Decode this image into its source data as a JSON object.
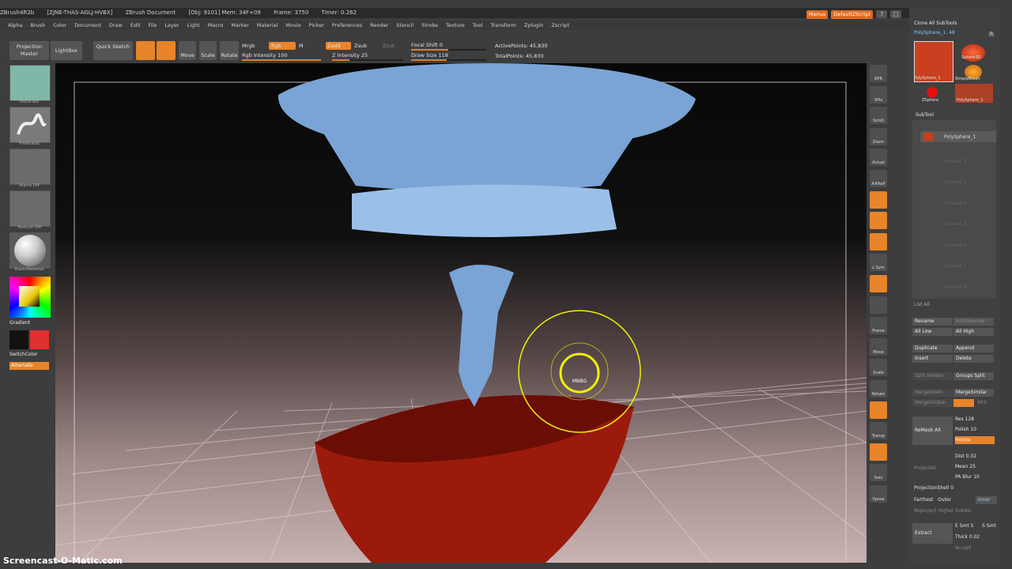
{
  "title_bar": {
    "app": "ZBrush4R2b",
    "session": "[ZJNE-THAS-AGLJ-HVBX]",
    "document": "ZBrush Document",
    "obj": "[Obj: 9101] Mem: 34F+09",
    "frame": "Frame: 3750",
    "timer": "Timer: 0.262"
  },
  "top_right": {
    "menus_chip": "Menus",
    "script_chip": "DefaultZScript",
    "win_btns": [
      "?",
      "□",
      "⊡",
      "–",
      "□",
      "✕"
    ]
  },
  "menu": [
    "Alpha",
    "Brush",
    "Color",
    "Document",
    "Draw",
    "Edit",
    "File",
    "Layer",
    "Light",
    "Macro",
    "Marker",
    "Material",
    "Movie",
    "Picker",
    "Preferences",
    "Render",
    "Stencil",
    "Stroke",
    "Texture",
    "Tool",
    "Transform",
    "Zplugin",
    "Zscript"
  ],
  "toolbar": {
    "projection_master": "Projection Master",
    "lightbox": "LightBox",
    "quick_sketch": "Quick Sketch",
    "move": "Move",
    "scale": "Scale",
    "rotate": "Rotate",
    "mrgb": "Mrgb",
    "rgb": "Rgb",
    "m": "M",
    "zadd": "Zadd",
    "zsub": "Zsub",
    "zcut": "Zcut",
    "rgb_intensity": "Rgb Intensity 100",
    "z_intensity": "Z Intensity 25",
    "focal_shift": "Focal Shift 0",
    "draw_size": "Draw Size 118",
    "active_points": "ActivePoints: 45,830",
    "total_points": "TotalPoints: 45,830"
  },
  "left_shelf": [
    "MoveTab",
    "Freehand",
    "Alpha Off",
    "Texture Off",
    "BasicMaterial"
  ],
  "colors": {
    "gradient": "Gradient",
    "switch_color": "SwitchColor",
    "alternate": "Alternate",
    "main_color": "#111111",
    "secondary_color": "#e03030",
    "accent": "#e8842a"
  },
  "viewport": {
    "brush_tag": "MNBG"
  },
  "right_icons": [
    "BPR",
    "SPix",
    "Scroll",
    "Zoom",
    "Actual",
    "AAHalf",
    "",
    "",
    "",
    "L.Sym",
    "",
    "",
    "Frame",
    "Move",
    "Scale",
    "Rotate",
    "",
    "Transp",
    "",
    "Solo",
    "Xpose"
  ],
  "right_panel": {
    "clone": "Clone All SubTools",
    "tool_name": "PolySphere_1. 48",
    "r_btn": "R",
    "tool_thumbs": [
      "PolySphere_1",
      "Sphere3D",
      "SimpleBrush",
      "ZSphere",
      "PolySphere_1"
    ],
    "subtool_header": "SubTool",
    "subtool_items": [
      "PolySphere_1",
      "Unused 2",
      "Unused 3",
      "Unused 4",
      "Unused 5",
      "Unused 6",
      "Unused 7",
      "Unused 8"
    ],
    "list_all": "List All",
    "rename": "Rename",
    "autoreorder": "AutoReorder",
    "all_low": "All Low",
    "all_high": "All High",
    "duplicate": "Duplicate",
    "append": "Append",
    "insert": "Insert",
    "delete": "Delete",
    "split_hidden": "Split Hidden",
    "groups_split": "Groups Split",
    "merge_down": "MergeDown",
    "merge_similar": "MergeSimilar",
    "merge_visible": "MergeVisible",
    "weld": "Wld",
    "remesh_all": "ReMesh All",
    "res": "Res 128",
    "polish": "Polish 10",
    "polygroups": "PolyGrp",
    "project_all": "ProjectAll",
    "dist": "Dist 0.02",
    "mean": "Mean 25",
    "pa_blur": "PA Blur 10",
    "projection_shell": "ProjectionShell 0",
    "farthest": "Farthest",
    "outer": "Outer",
    "inner": "Inner",
    "reproject": "Reproject Higher Subdiv",
    "extract": "Extract",
    "e_smt": "E Smt 5",
    "s_smt": "S Smt",
    "thick": "Thick 0.02",
    "accept": "Accept"
  },
  "watermark": "Screencast-O-Matic.com"
}
